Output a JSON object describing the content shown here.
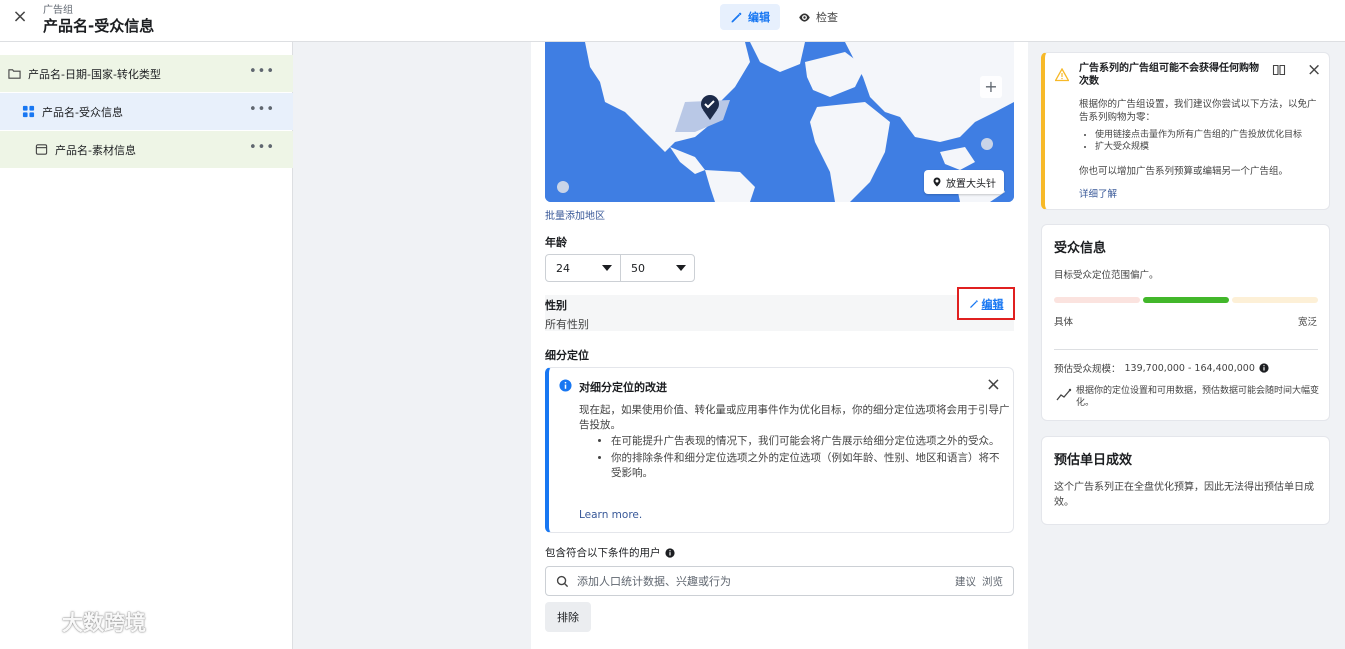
{
  "header": {
    "breadcrumb": "广告组",
    "title": "产品名-受众信息",
    "tabs": [
      {
        "label": "编辑",
        "icon": "pencil-icon",
        "active": true
      },
      {
        "label": "检查",
        "icon": "eye-icon",
        "active": false
      }
    ]
  },
  "tree": {
    "items": [
      {
        "label": "产品名-日期-国家-转化类型",
        "icon": "folder-icon"
      },
      {
        "label": "产品名-受众信息",
        "icon": "grid-icon"
      },
      {
        "label": "产品名-素材信息",
        "icon": "ad-icon"
      }
    ],
    "more": "•••"
  },
  "watermark": "大数跨境",
  "editor": {
    "map_pin_button": "放置大头针",
    "map_zoom": "+",
    "bulk_add_link": "批量添加地区",
    "age": {
      "label": "年龄",
      "min": "24",
      "max": "50"
    },
    "gender": {
      "label": "性别",
      "value": "所有性别",
      "edit": "编辑"
    },
    "detailed_targeting_label": "细分定位",
    "notice": {
      "title": "对细分定位的改进",
      "body": "现在起，如果使用价值、转化量或应用事件作为优化目标，你的细分定位选项将会用于引导广告投放。",
      "bullets": [
        "在可能提升广告表现的情况下，我们可能会将广告展示给细分定位选项之外的受众。",
        "你的排除条件和细分定位选项之外的定位选项（例如年龄、性别、地区和语言）将不受影响。"
      ],
      "link": "Learn more."
    },
    "include_label": "包含符合以下条件的用户",
    "search_placeholder": "添加人口统计数据、兴趣或行为",
    "search_suggest": "建议",
    "search_browse": "浏览",
    "exclude_button": "排除"
  },
  "warning_card": {
    "title": "广告系列的广告组可能不会获得任何购物次数",
    "body": "根据你的广告组设置，我们建议你尝试以下方法，以免广告系列购物为零：",
    "bullets": [
      "使用链接点击量作为所有广告组的广告投放优化目标",
      "扩大受众规模"
    ],
    "extra": "你也可以增加广告系列预算或编辑另一个广告组。",
    "link": "详细了解"
  },
  "audience_card": {
    "title": "受众信息",
    "subtitle": "目标受众定位范围偏广。",
    "meter_left": "具体",
    "meter_right": "宽泛",
    "meter_position": "middle",
    "size_label": "预估受众规模：",
    "size_value": "139,700,000 - 164,400,000",
    "trend_text": "根据你的定位设置和可用数据，预估数据可能会随时间大幅变化。"
  },
  "daily_card": {
    "title": "预估单日成效",
    "body": "这个广告系列正在全盘优化预算，因此无法得出预估单日成效。"
  },
  "colors": {
    "accent": "#1877f2",
    "warning": "#f7b928",
    "highlight_border": "#e02020",
    "meter_active": "#42b72a"
  }
}
